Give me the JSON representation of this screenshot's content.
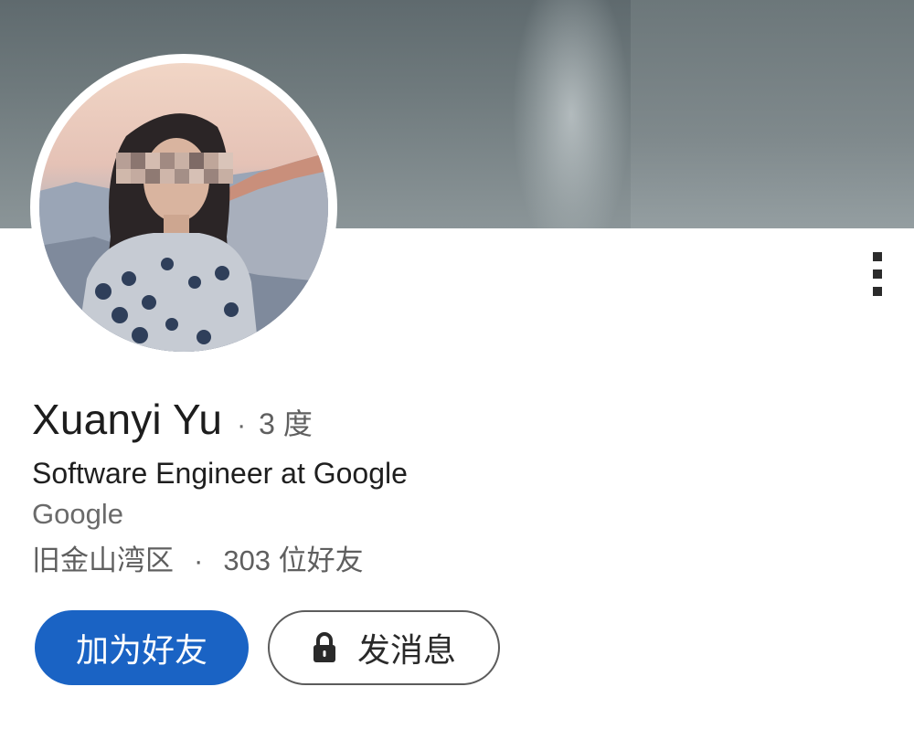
{
  "profile": {
    "name": "Xuanyi Yu",
    "degree_separator": "·",
    "degree": "3 度",
    "headline": "Software Engineer at Google",
    "company": "Google",
    "location": "旧金山湾区",
    "location_separator": "·",
    "connections": "303 位好友"
  },
  "actions": {
    "connect_label": "加为好友",
    "message_label": "发消息"
  },
  "icons": {
    "more": "more-vertical-icon",
    "lock": "lock-icon"
  },
  "colors": {
    "primary_button": "#1a63c4",
    "banner": "#6f7a7d"
  }
}
